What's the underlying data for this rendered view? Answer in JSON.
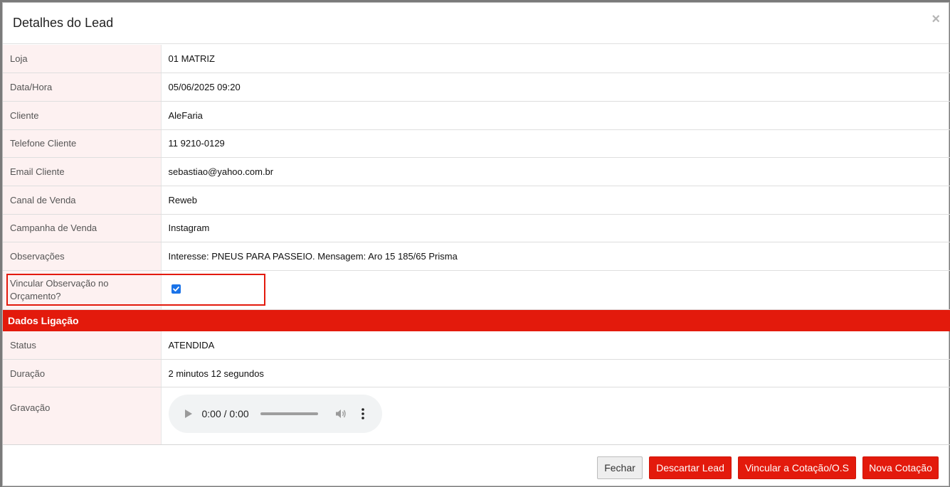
{
  "modal": {
    "title": "Detalhes do Lead",
    "close_symbol": "×"
  },
  "fields": [
    {
      "label": "Loja",
      "value": "01 MATRIZ"
    },
    {
      "label": "Data/Hora",
      "value": "05/06/2025 09:20"
    },
    {
      "label": "Cliente",
      "value": "AleFaria"
    },
    {
      "label": "Telefone Cliente",
      "value": "11 9210-0129"
    },
    {
      "label": "Email Cliente",
      "value": "sebastiao@yahoo.com.br"
    },
    {
      "label": "Canal de Venda",
      "value": "Reweb"
    },
    {
      "label": "Campanha de Venda",
      "value": "Instagram"
    },
    {
      "label": "Observações",
      "value": "Interesse: PNEUS PARA PASSEIO. Mensagem: Aro 15 185/65 Prisma"
    }
  ],
  "vincular": {
    "label": "Vincular Observação no Orçamento?",
    "checked": true
  },
  "section": {
    "title": "Dados Ligação"
  },
  "call_fields": [
    {
      "label": "Status",
      "value": "ATENDIDA"
    },
    {
      "label": "Duração",
      "value": "2 minutos 12 segundos"
    }
  ],
  "recording": {
    "label": "Gravação",
    "time": "0:00 / 0:00"
  },
  "footer": {
    "close_label": "Fechar",
    "discard_label": "Descartar Lead",
    "link_label": "Vincular a Cotação/O.S",
    "new_label": "Nova Cotação"
  },
  "colors": {
    "accent": "#e31a0c",
    "label_bg": "#fdf1f1",
    "checkbox": "#1a73e8"
  }
}
